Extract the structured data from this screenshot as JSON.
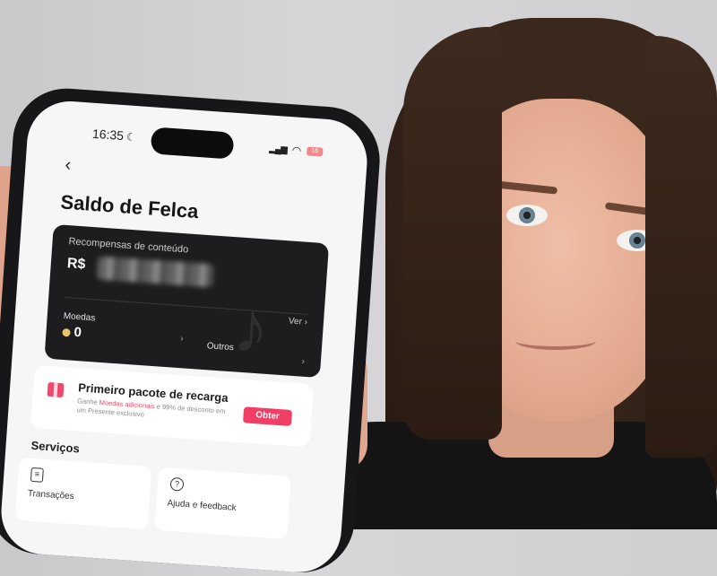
{
  "phone": {
    "status": {
      "time": "16:35",
      "battery": "16"
    },
    "page_title": "Saldo de Felca",
    "balance_card": {
      "label": "Recompensas de conteúdo",
      "currency": "R$",
      "view_label": "Ver",
      "coins_label": "Moedas",
      "coins_value": "0",
      "others_label": "Outros"
    },
    "promo": {
      "title": "Primeiro pacote de recarga",
      "desc_prefix": "Ganhe ",
      "desc_highlight": "Moedas adicionais",
      "desc_suffix": " e 99% de desconto em um Presente exclusivo",
      "button_label": "Obter"
    },
    "services": {
      "title": "Serviços",
      "items": [
        {
          "label": "Transações",
          "icon": "receipt-icon"
        },
        {
          "label": "Ajuda e feedback",
          "icon": "help-icon"
        }
      ]
    }
  },
  "colors": {
    "accent": "#f03e64",
    "card_dark": "#1d1d20",
    "screen_bg": "#f6f6f7"
  }
}
